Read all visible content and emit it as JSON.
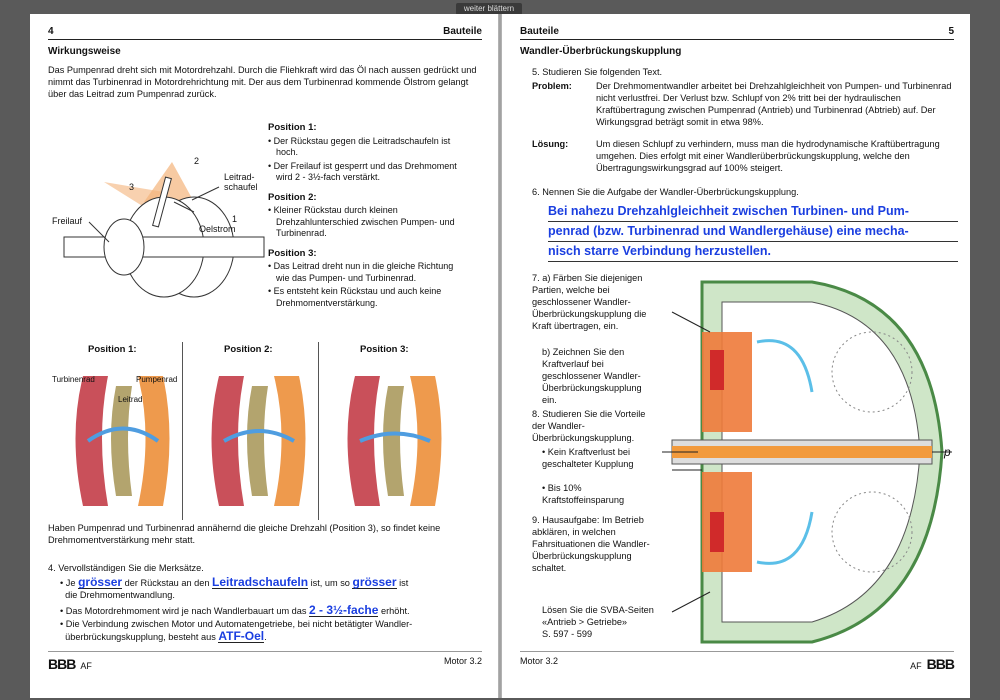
{
  "toolbar": {
    "next_page": "weiter blättern"
  },
  "left": {
    "page_no": "4",
    "section": "Bauteile",
    "title": "Wirkungsweise",
    "intro": "Das Pumpenrad dreht sich mit Motordrehzahl. Durch die Fliehkraft wird das Öl nach aussen gedrückt und nimmt das Turbinenrad in Motordrehrichtung mit. Der aus dem Turbinenrad kommende Ölstrom gelangt über das Leitrad zum Pumpenrad zurück.",
    "diag_labels": {
      "freilauf": "Freilauf",
      "leitrad": "Leitrad-",
      "schaufel": "schaufel",
      "oelstrom": "Oelstrom",
      "n1": "1",
      "n2": "2",
      "n3": "3"
    },
    "positions": [
      {
        "title": "Position 1:",
        "items": [
          "Der Rückstau gegen die Leitradschaufeln ist hoch.",
          "Der Freilauf ist gesperrt und das Drehmoment wird 2 - 3½-fach verstärkt."
        ]
      },
      {
        "title": "Position 2:",
        "items": [
          "Kleiner Rückstau durch kleinen Drehzahlunterschied zwischen Pumpen- und Turbinenrad."
        ]
      },
      {
        "title": "Position 3:",
        "items": [
          "Das Leitrad dreht nun in die gleiche Richtung wie das Pumpen- und Turbinenrad.",
          "Es entsteht kein Rückstau und auch keine Drehmomentverstärkung."
        ]
      }
    ],
    "pos_heads": [
      "Position 1:",
      "Position 2:",
      "Position 3:"
    ],
    "wheel_labels": {
      "turbinenrad": "Turbinenrad",
      "pumpenrad": "Pumpenrad",
      "leitrad": "Leitrad"
    },
    "summary": "Haben Pumpenrad und Turbinenrad annähernd die gleiche Drehzahl (Position 3), so findet keine Drehmomentverstärkung mehr statt.",
    "task4": "4. Vervollständigen Sie die Merksätze.",
    "s1a": "Je",
    "s1_ans1": "grösser",
    "s1b": "der Rückstau an den",
    "s1_ans2": "Leitradschaufeln",
    "s1c": "ist, um so",
    "s1_ans3": "grösser",
    "s1d": "ist",
    "s1e": "die Drehmomentwandlung.",
    "s2a": "Das Motordrehmoment wird je nach Wandlerbauart um das",
    "s2_ans": "2 - 3½-fache",
    "s2b": "erhöht.",
    "s3a": "Die Verbindung zwischen Motor und Automatengetriebe, bei nicht betätigter Wandler-",
    "s3b": "überbrückungskupplung, besteht aus",
    "s3_ans": "ATF-Oel",
    "s3c": ".",
    "footer_logo": "BBB",
    "footer_af": "AF",
    "footer_right": "Motor 3.2"
  },
  "right": {
    "section": "Bauteile",
    "page_no": "5",
    "title": "Wandler-Überbrückungskupplung",
    "task5": "5. Studieren Sie folgenden Text.",
    "problem_label": "Problem:",
    "problem": "Der Drehmomentwandler arbeitet bei Drehzahlgleichheit von Pumpen- und Turbinenrad nicht verlustfrei. Der Verlust bzw. Schlupf von 2% tritt bei der hydraulischen Kraftübertragung zwischen Pumpenrad (Antrieb) und Turbinenrad (Abtrieb) auf. Der Wirkungsgrad beträgt somit in etwa 98%.",
    "loesung_label": "Lösung:",
    "loesung": "Um diesen Schlupf zu verhindern, muss man die hydrodynamische Kraftübertragung umgehen. Dies erfolgt mit einer Wandlerüberbrückungskupplung, welche den Übertragungswirkungsgrad auf 100% steigert.",
    "task6": "6. Nennen Sie die Aufgabe der Wandler-Überbrückungskupplung.",
    "answer6": [
      "Bei nahezu Drehzahlgleichheit zwischen Turbinen- und Pum-",
      "penrad (bzw. Turbinenrad und Wandlergehäuse) eine mecha-",
      "nisch starre Verbindung herzustellen."
    ],
    "task7a": "7. a) Färben Sie diejenigen Partien, welche bei geschlossener Wandler-Überbrückungskupplung die Kraft übertragen, ein.",
    "task7b": "b) Zeichnen Sie den Kraftverlauf bei geschlossener Wandler-Überbrückungskupplung ein.",
    "task8": "8. Studieren Sie die Vorteile der Wandler-Überbrückungskupplung.",
    "adv": [
      "Kein Kraftverlust bei geschalteter Kupplung",
      "Bis 10% Kraftstoffeinsparung"
    ],
    "task9": "9. Hausaufgabe: Im Betrieb abklären, in welchen Fahrsituationen die Wandler-Überbrückungskupplung schaltet.",
    "svba": [
      "Lösen Sie die SVBA-Seiten",
      "«Antrieb > Getriebe»",
      "S. 597 - 599"
    ],
    "p_label": "p",
    "footer_left": "Motor 3.2",
    "footer_af": "AF",
    "footer_logo": "BBB"
  }
}
